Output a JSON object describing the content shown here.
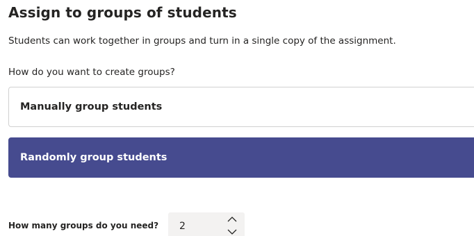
{
  "header": {
    "title": "Assign to groups of students",
    "description": "Students can work together in groups and turn in a single copy of the assignment."
  },
  "grouping": {
    "question": "How do you want to create groups?",
    "options": [
      {
        "label": "Manually group students",
        "selected": false
      },
      {
        "label": "Randomly group students",
        "selected": true
      }
    ],
    "selected_color": "#464b8f"
  },
  "group_count": {
    "label": "How many groups do you need?",
    "value": "2",
    "increment_icon": "chevron-up-icon",
    "decrement_icon": "chevron-down-icon"
  }
}
